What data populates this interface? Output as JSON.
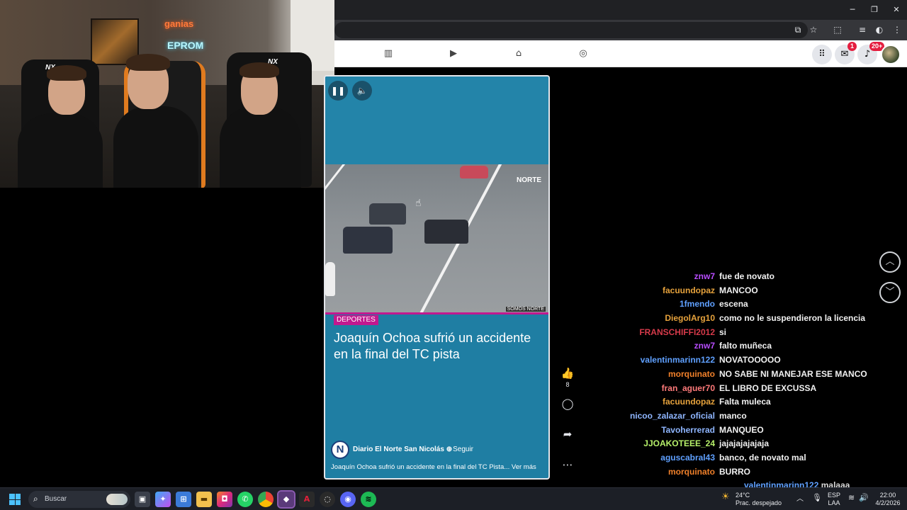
{
  "browser": {
    "window_controls": {
      "minimize": "─",
      "restore": "❐",
      "close": "✕"
    }
  },
  "fb_header": {
    "messenger_badge": "1",
    "notifications_badge": "20+"
  },
  "webcam": {
    "neon_top": "ganias",
    "neon_bottom": "EPROM",
    "chair_logo": "NX"
  },
  "reel": {
    "video_logo": "NORTE",
    "video_watermark": "SOMOS NORTE",
    "category_tag": "DEPORTES",
    "headline": "Joaquín Ochoa sufrió un accidente en la final del TC pista",
    "page_logo_letter": "N",
    "page_name": "Diario El Norte San Nicolás",
    "follow_label": "· Seguir",
    "caption": "Joaquín Ochoa sufrió un accidente en la final del TC Pista... Ver más",
    "progress": 0.32,
    "like_count": "8"
  },
  "chat": [
    {
      "user": "znw7",
      "color": "#b94dff",
      "message": "fue de novato"
    },
    {
      "user": "facuundopaz",
      "color": "#e6a23c",
      "message": "MANCOO"
    },
    {
      "user": "1fmendo",
      "color": "#5fa0ff",
      "message": "escena"
    },
    {
      "user": "DiegolArg10",
      "color": "#e6a23c",
      "message": "como no le suspendieron la licencia"
    },
    {
      "user": "FRANSCHIFFI2012",
      "color": "#d63a4a",
      "message": "si"
    },
    {
      "user": "znw7",
      "color": "#b94dff",
      "message": "falto muñeca"
    },
    {
      "user": "valentinmarinn122",
      "color": "#5fa0ff",
      "message": "NOVATOOOOO"
    },
    {
      "user": "morquinato",
      "color": "#f0802a",
      "message": "NO SABE NI MANEJAR ESE MANCO"
    },
    {
      "user": "fran_aguer70",
      "color": "#ff7a7a",
      "message": "EL LIBRO DE EXCUSSA"
    },
    {
      "user": "facuundopaz",
      "color": "#e6a23c",
      "message": "Falta muleca"
    },
    {
      "user": "nicoo_zalazar_oficial",
      "color": "#8fb6ff",
      "message": "manco"
    },
    {
      "user": "Tavoherrerad",
      "color": "#8fb6ff",
      "message": "MANQUEO"
    },
    {
      "user": "JJOAKOTEEE_24",
      "color": "#b6f06a",
      "message": "jajajajajajaja"
    },
    {
      "user": "aguscabral43",
      "color": "#5fa0ff",
      "message": "banco, de novato mal"
    },
    {
      "user": "morquinato",
      "color": "#f0802a",
      "message": "BURRO"
    }
  ],
  "chat_partial": {
    "user": "valentinmarinn122",
    "message": "malaaa"
  },
  "taskbar": {
    "search_placeholder": "Buscar",
    "weather_temp": "24°C",
    "weather_desc": "Prac. despejado",
    "lang_top": "ESP",
    "lang_bottom": "LAA",
    "time": "22:00",
    "date": "4/2/2026"
  }
}
